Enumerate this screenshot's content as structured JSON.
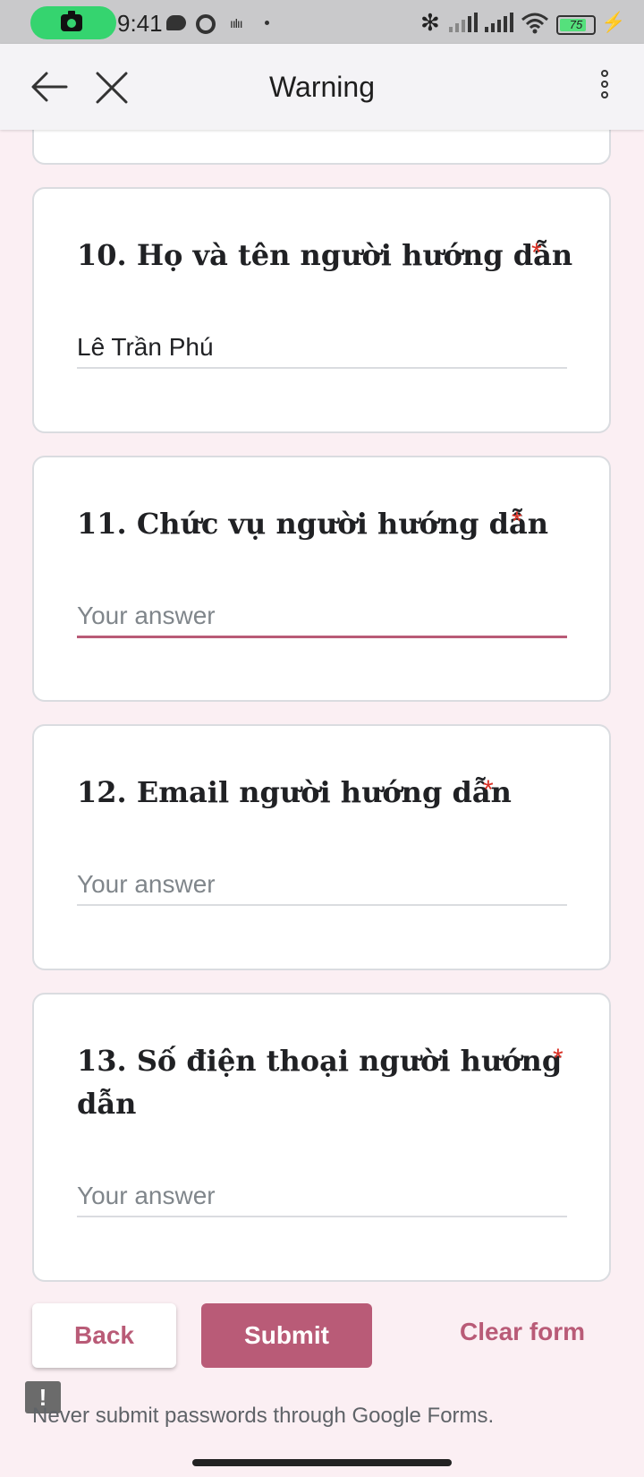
{
  "status_bar": {
    "time": "9:41",
    "battery": "75"
  },
  "app_bar": {
    "title": "Warning"
  },
  "questions": [
    {
      "title": "10. Họ và tên người hướng dẫn",
      "required_mark": "*",
      "value": "Lê Trần Phú",
      "placeholder": "Your answer"
    },
    {
      "title": "11. Chức vụ người hướng dẫn",
      "required_mark": "*",
      "value": "",
      "placeholder": "Your answer"
    },
    {
      "title": "12. Email người hướng dẫn",
      "required_mark": "*",
      "value": "",
      "placeholder": "Your answer"
    },
    {
      "title_line1": "13. Số điện thoại người hướng",
      "title_line2": "dẫn",
      "required_mark": "*",
      "value": "",
      "placeholder": "Your answer"
    }
  ],
  "footer": {
    "back_label": "Back",
    "submit_label": "Submit",
    "clear_label": "Clear form",
    "warning_glyph": "!",
    "notice": "Never submit passwords through Google Forms."
  },
  "colors": {
    "accent": "#b95b77",
    "required": "#d93025",
    "background": "#fbeff3"
  },
  "icons": [
    "camera-icon",
    "message-icon",
    "ring-icon",
    "waveform-icon",
    "bluetooth-icon",
    "signal-icon",
    "wifi-icon",
    "battery-icon",
    "charging-icon",
    "back-arrow-icon",
    "close-icon",
    "more-vert-icon",
    "warning-icon"
  ]
}
